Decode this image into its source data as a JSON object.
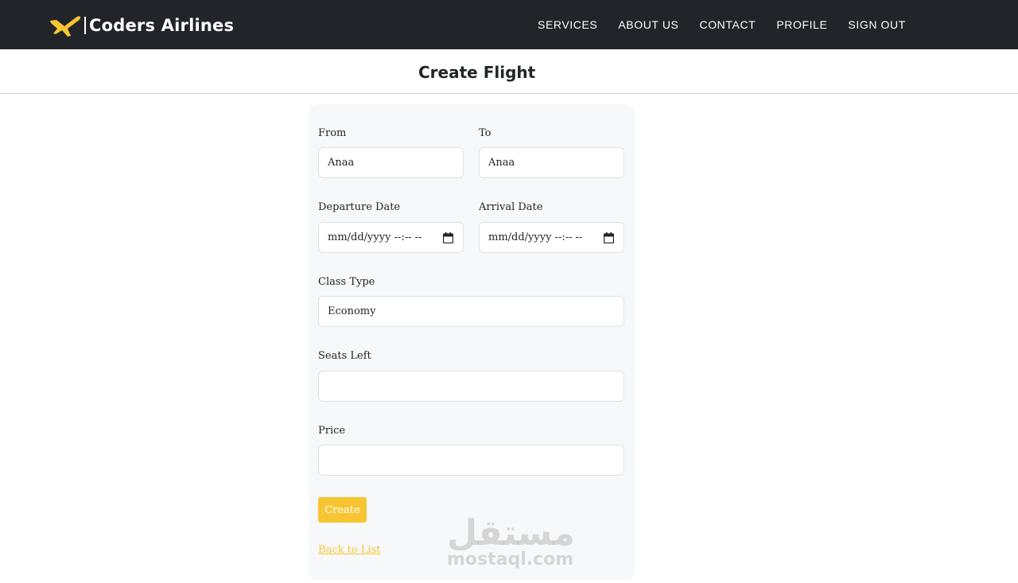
{
  "navbar": {
    "brand": "Coders Airlines",
    "links": [
      "SERVICES",
      "ABOUT US",
      "CONTACT",
      "PROFILE",
      "SIGN OUT"
    ],
    "brand_icon": "airplane-icon",
    "accent_color": "#f7c531"
  },
  "page": {
    "title": "Create Flight"
  },
  "form": {
    "from": {
      "label": "From",
      "value": "Anaa"
    },
    "to": {
      "label": "To",
      "value": "Anaa"
    },
    "departure_date": {
      "label": "Departure Date",
      "placeholder": "mm/dd/yyyy --:-- --"
    },
    "arrival_date": {
      "label": "Arrival Date",
      "placeholder": "mm/dd/yyyy --:-- --"
    },
    "class_type": {
      "label": "Class Type",
      "value": "Economy"
    },
    "seats_left": {
      "label": "Seats Left",
      "value": ""
    },
    "price": {
      "label": "Price",
      "value": ""
    },
    "create_label": "Create",
    "back_label": "Back to List"
  },
  "watermark": {
    "arabic": "مستقل",
    "latin": "mostaql.com"
  }
}
